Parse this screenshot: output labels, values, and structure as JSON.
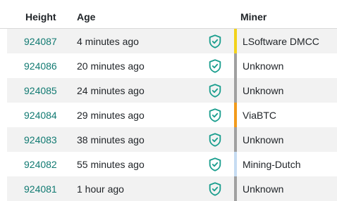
{
  "headers": {
    "height": "Height",
    "age": "Age",
    "miner": "Miner"
  },
  "colors": {
    "link": "#117a72",
    "shield": "#1a9e8e",
    "row_stripe": "#f2f2f2"
  },
  "blocks": [
    {
      "height": "924087",
      "age": "4 minutes ago",
      "miner": "LSoftware DMCC",
      "pool_color": "#f2d21b",
      "icon": "shield-check-icon"
    },
    {
      "height": "924086",
      "age": "20 minutes ago",
      "miner": "Unknown",
      "pool_color": "#a0a0a0",
      "icon": "shield-check-icon"
    },
    {
      "height": "924085",
      "age": "24 minutes ago",
      "miner": "Unknown",
      "pool_color": "#a0a0a0",
      "icon": "shield-check-icon"
    },
    {
      "height": "924084",
      "age": "29 minutes ago",
      "miner": "ViaBTC",
      "pool_color": "#f29a1b",
      "icon": "shield-check-icon"
    },
    {
      "height": "924083",
      "age": "38 minutes ago",
      "miner": "Unknown",
      "pool_color": "#a0a0a0",
      "icon": "shield-check-icon"
    },
    {
      "height": "924082",
      "age": "55 minutes ago",
      "miner": "Mining-Dutch",
      "pool_color": "#c6dcf2",
      "icon": "shield-check-icon"
    },
    {
      "height": "924081",
      "age": "1 hour ago",
      "miner": "Unknown",
      "pool_color": "#a0a0a0",
      "icon": "shield-check-icon"
    }
  ]
}
